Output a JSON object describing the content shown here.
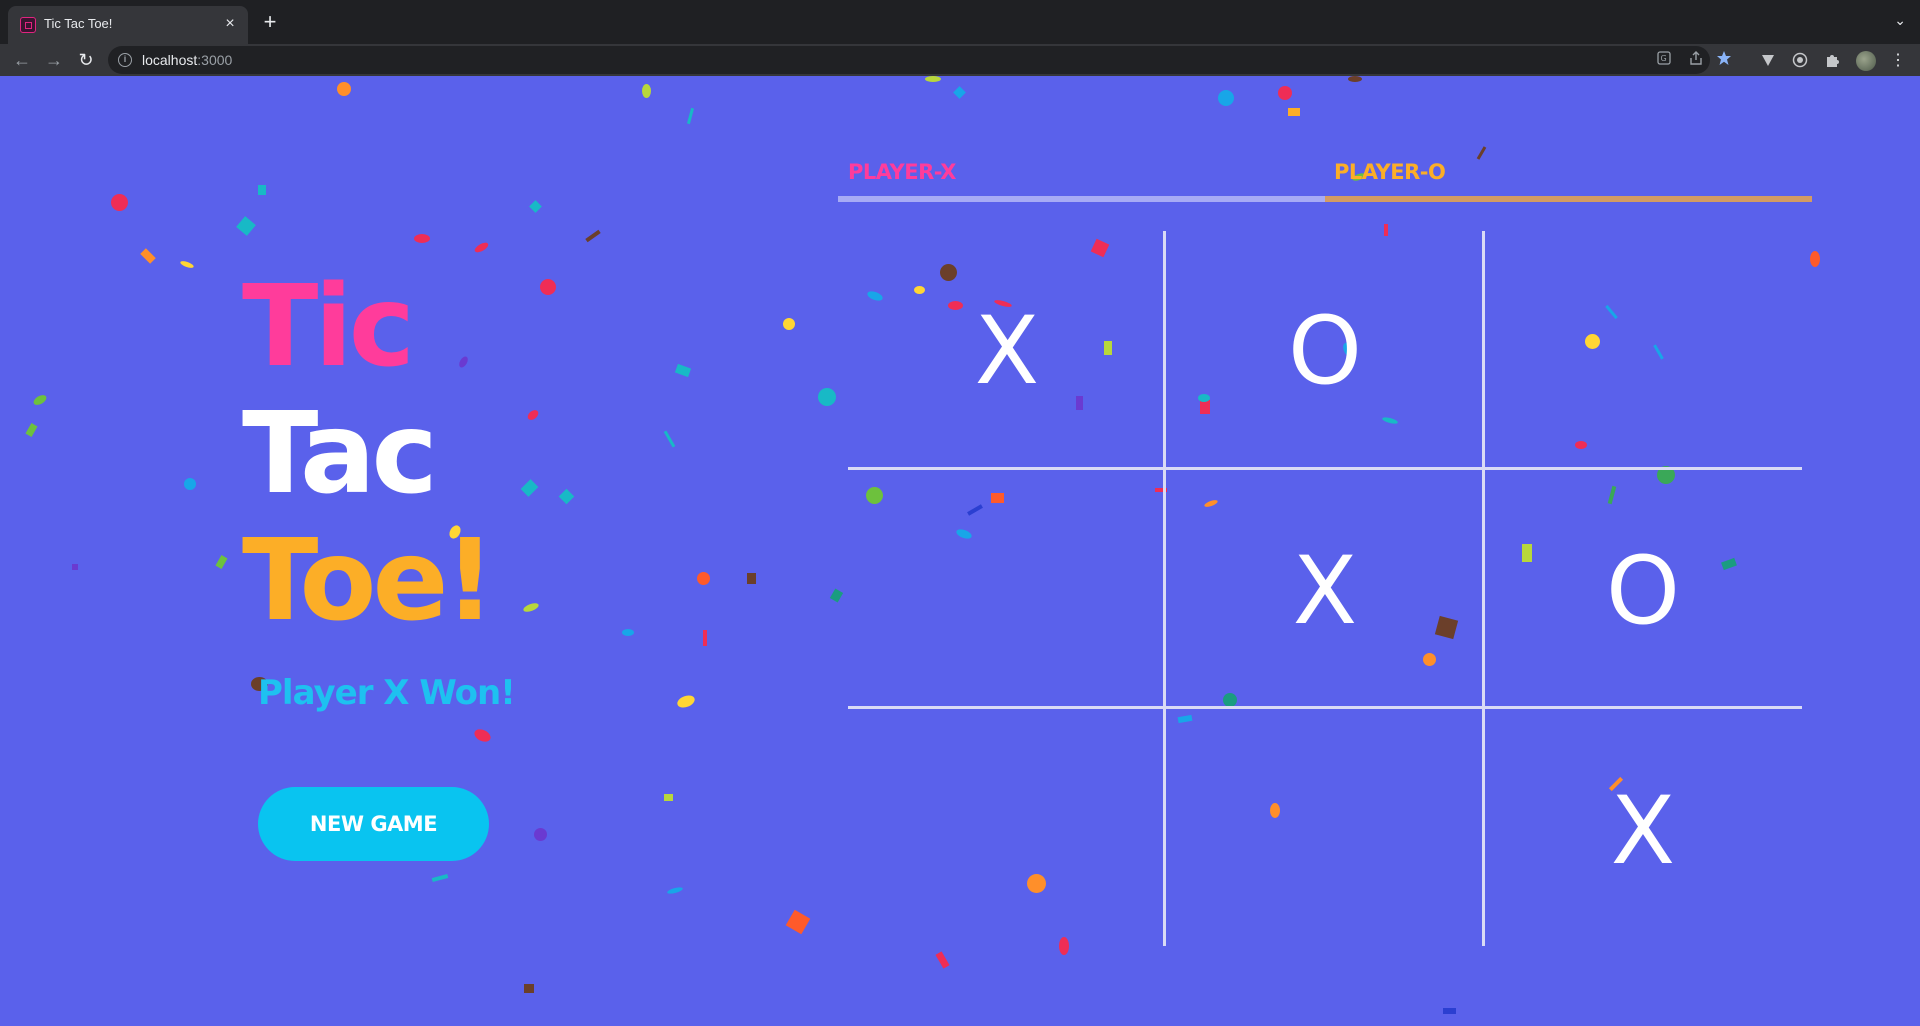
{
  "browser": {
    "tab": {
      "title": "Tic Tac Toe!",
      "close_icon": "×"
    },
    "new_tab_icon": "+",
    "tab_menu_icon": "⌄",
    "nav": {
      "back_icon": "←",
      "forward_icon": "→",
      "reload_icon": "↻"
    },
    "address": {
      "host": "localhost",
      "port": ":3000"
    },
    "icons": [
      "translate-icon",
      "share-icon",
      "bookmark-star-icon",
      "extension-v-icon",
      "extension-circle-icon",
      "puzzle-icon",
      "profile-avatar",
      "menu-icon"
    ]
  },
  "game": {
    "title_lines": [
      "Tic",
      "Tac",
      "Toe!"
    ],
    "status": "Player X Won!",
    "new_game_label": "NEW GAME",
    "scoreboard": {
      "x_label": "PLAYER-X",
      "o_label": "PLAYER-O"
    },
    "board": [
      [
        "X",
        "O",
        ""
      ],
      [
        "",
        "X",
        "O"
      ],
      [
        "",
        "",
        "X"
      ]
    ],
    "colors": {
      "background": "#5a61eb",
      "pink": "#ff3c9b",
      "orange": "#fcae27",
      "cyan": "#09c4f0",
      "grid": "#d9dbf5"
    }
  }
}
